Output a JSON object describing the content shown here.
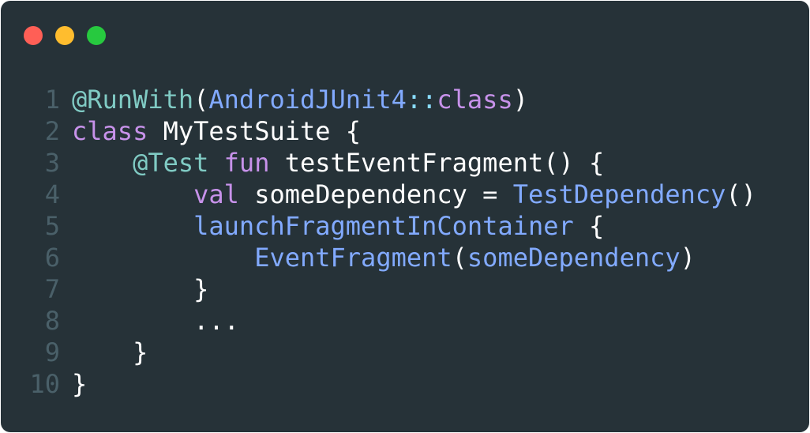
{
  "window": {
    "controls": [
      {
        "name": "close",
        "color": "#ff5f56"
      },
      {
        "name": "minimize",
        "color": "#ffbd2e"
      },
      {
        "name": "zoom",
        "color": "#27c93f"
      }
    ],
    "background": "#263238"
  },
  "code": {
    "language": "kotlin",
    "lines": [
      {
        "number": "1",
        "tokens": [
          {
            "text": "@RunWith",
            "kind": "annotation"
          },
          {
            "text": "(",
            "kind": "punct"
          },
          {
            "text": "AndroidJUnit4",
            "kind": "type"
          },
          {
            "text": "::",
            "kind": "colons"
          },
          {
            "text": "class",
            "kind": "keyword"
          },
          {
            "text": ")",
            "kind": "punct"
          }
        ]
      },
      {
        "number": "2",
        "tokens": [
          {
            "text": "class",
            "kind": "keyword"
          },
          {
            "text": " MyTestSuite {",
            "kind": "plain"
          }
        ]
      },
      {
        "number": "3",
        "tokens": [
          {
            "text": "    ",
            "kind": "plain"
          },
          {
            "text": "@Test",
            "kind": "annotation"
          },
          {
            "text": " ",
            "kind": "plain"
          },
          {
            "text": "fun",
            "kind": "keyword"
          },
          {
            "text": " testEventFragment() {",
            "kind": "plain"
          }
        ]
      },
      {
        "number": "4",
        "tokens": [
          {
            "text": "        ",
            "kind": "plain"
          },
          {
            "text": "val",
            "kind": "keyword"
          },
          {
            "text": " someDependency = ",
            "kind": "plain"
          },
          {
            "text": "TestDependency",
            "kind": "type"
          },
          {
            "text": "()",
            "kind": "punct"
          }
        ]
      },
      {
        "number": "5",
        "tokens": [
          {
            "text": "        ",
            "kind": "plain"
          },
          {
            "text": "launchFragmentInContainer",
            "kind": "func"
          },
          {
            "text": " {",
            "kind": "plain"
          }
        ]
      },
      {
        "number": "6",
        "tokens": [
          {
            "text": "            ",
            "kind": "plain"
          },
          {
            "text": "EventFragment",
            "kind": "type"
          },
          {
            "text": "(",
            "kind": "punct"
          },
          {
            "text": "someDependency",
            "kind": "func"
          },
          {
            "text": ")",
            "kind": "punct"
          }
        ]
      },
      {
        "number": "7",
        "tokens": [
          {
            "text": "        }",
            "kind": "plain"
          }
        ]
      },
      {
        "number": "8",
        "tokens": [
          {
            "text": "        ...",
            "kind": "plain"
          }
        ]
      },
      {
        "number": "9",
        "tokens": [
          {
            "text": "    }",
            "kind": "plain"
          }
        ]
      },
      {
        "number": "10",
        "tokens": [
          {
            "text": "}",
            "kind": "plain"
          }
        ]
      }
    ]
  }
}
